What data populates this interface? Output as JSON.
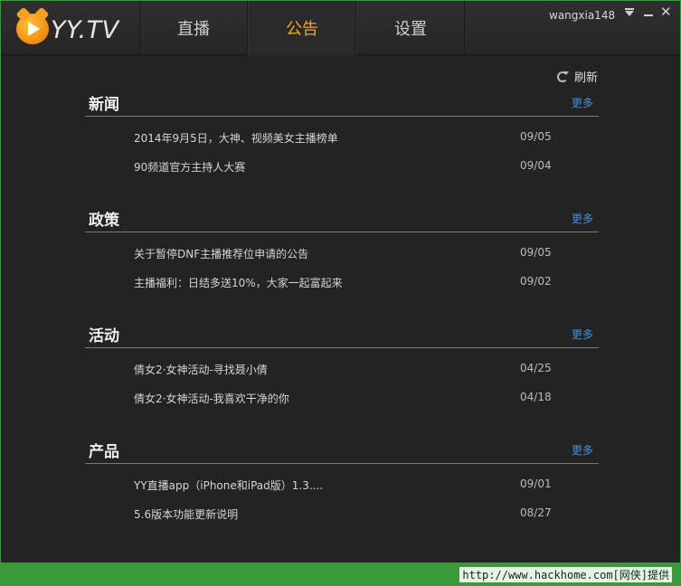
{
  "app": {
    "logo_text": "YY.TV",
    "brand_color": "#f5a623"
  },
  "tabs": [
    {
      "label": "直播"
    },
    {
      "label": "公告",
      "active": true
    },
    {
      "label": "设置"
    }
  ],
  "user": {
    "name": "wangxia148"
  },
  "toolbar": {
    "refresh_label": "刷新"
  },
  "sections": [
    {
      "title": "新闻",
      "more": "更多",
      "items": [
        {
          "title": "2014年9月5日，大神、视频美女主播榜单",
          "date": "09/05"
        },
        {
          "title": "90频道官方主持人大赛",
          "date": "09/04"
        }
      ]
    },
    {
      "title": "政策",
      "more": "更多",
      "items": [
        {
          "title": "关于暂停DNF主播推荐位申请的公告",
          "date": "09/05"
        },
        {
          "title": "主播福利：日结多送10%，大家一起富起来",
          "date": "09/02"
        }
      ]
    },
    {
      "title": "活动",
      "more": "更多",
      "items": [
        {
          "title": "倩女2·女神活动-寻找聂小倩",
          "date": "04/25"
        },
        {
          "title": "倩女2·女神活动-我喜欢干净的你",
          "date": "04/18"
        }
      ]
    },
    {
      "title": "产品",
      "more": "更多",
      "items": [
        {
          "title": "YY直播app（iPhone和iPad版）1.3....",
          "date": "09/01"
        },
        {
          "title": "5.6版本功能更新说明",
          "date": "08/27"
        }
      ]
    }
  ],
  "footer": {
    "watermark": "http://www.hackhome.com[网侠]提供"
  },
  "icons": {
    "refresh": "refresh-icon",
    "dropdown": "dropdown-icon",
    "minimize": "minimize-icon",
    "close": "close-icon",
    "logo": "yy-logo-icon"
  },
  "colors": {
    "accent": "#f5a623",
    "link": "#4a8fd8",
    "background": "#232323",
    "frame": "#3a9a3a"
  }
}
